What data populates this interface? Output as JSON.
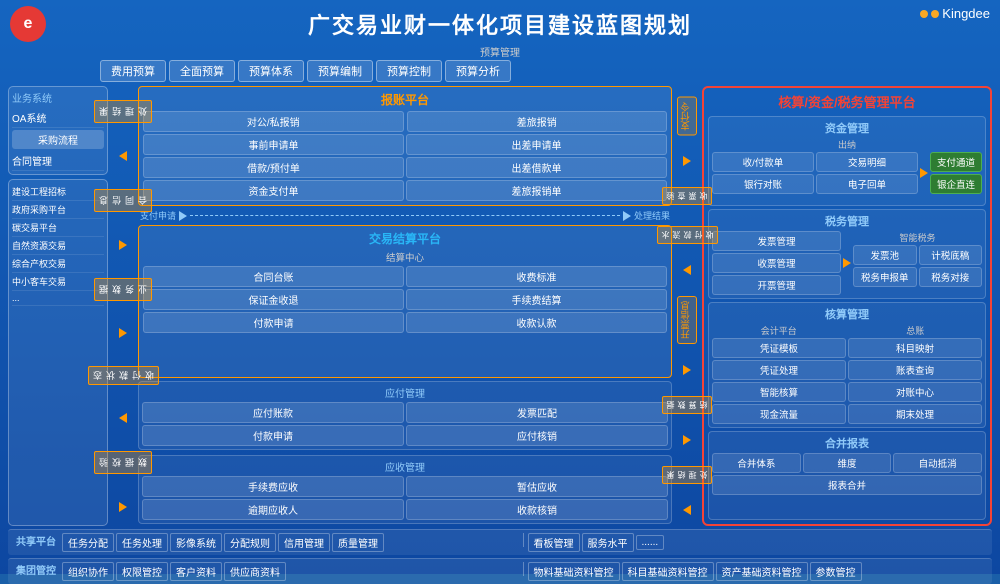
{
  "header": {
    "title": "广交易业财一体化项目建设蓝图规划",
    "logo_left": "e",
    "logo_right": "Kingdee"
  },
  "budget": {
    "label": "预算管理",
    "tabs": [
      "费用预算",
      "全面预算",
      "预算体系",
      "预算编制",
      "预算控制",
      "预算分析"
    ]
  },
  "right_platform": {
    "title": "核算/资金/税务管理平台",
    "fund_section": {
      "title": "资金管理",
      "subsection_title": "出纳",
      "items": [
        "收/付款单",
        "交易明细",
        "银行对账",
        "电子回单"
      ],
      "payment_channel": "支付通道",
      "bank_direct": "银企直连"
    },
    "tax_section": {
      "title": "税务管理",
      "smart_tax": "智能税务",
      "items": [
        "发票管理",
        "收票管理",
        "开票管理"
      ],
      "right_items": [
        "发票池",
        "计税底稿",
        "税务申报单",
        "税务对接"
      ]
    },
    "account_section": {
      "title": "核算管理",
      "platform": "会计平台",
      "general_ledger": "总账",
      "items": [
        "凭证模板",
        "科目映射",
        "凭证处理",
        "账表查询",
        "智能核算",
        "对账中心",
        "现金流量",
        "期末处理"
      ]
    },
    "merge_section": {
      "title": "合并报表",
      "items": [
        "合并体系",
        "维度",
        "自动抵消",
        "报表合并"
      ]
    }
  },
  "left": {
    "biz_section": {
      "title": "业务系统",
      "items": [
        "OA系统",
        "采购流程",
        "合同管理"
      ]
    },
    "project_section": {
      "items": [
        "建设工程招标",
        "政府采购平台",
        "碳交易平台",
        "自然资源交易",
        "综合产权交易",
        "中小客车交易",
        "..."
      ]
    }
  },
  "mid": {
    "expense_platform": {
      "title": "报账平台",
      "sections": {
        "public_expense": "对公/私报销",
        "travel_expense": "差旅报销",
        "pre_apply": "事前申请单",
        "travel_apply": "出差申请单",
        "loan": "借款/预付单",
        "travel_loan": "出差借款单",
        "fund_payment": "资金支付单",
        "travel_reimbursement": "差旅报销单"
      },
      "payment_cmd": "支付令",
      "ticket_check": "收票查验"
    },
    "trade_platform": {
      "title": "交易结算平台",
      "clearing_center": "结算中心",
      "items": [
        "合同台账",
        "收费标准",
        "保证金收退",
        "手续费结算",
        "付款申请",
        "收款认款"
      ],
      "invoice_info": "开票信息"
    },
    "payable_section": {
      "title": "应付管理",
      "items": [
        "应付账款",
        "发票匹配",
        "付款申请",
        "应付核销"
      ]
    },
    "receivable_section": {
      "title": "应收管理",
      "items": [
        "手续费应收",
        "暂估应收",
        "逾期应收人",
        "收款核销"
      ]
    },
    "side_labels": {
      "process_result": "处理结果",
      "contract_info": "合同信息",
      "biz_data": "业务数据",
      "payment_status": "收付款状态",
      "data_check": "数据校验",
      "payment_flow": "收付款流水",
      "settlement_data": "结算数据",
      "invoice_info": "开票信息",
      "process_result2": "处理结果"
    }
  },
  "bottom": {
    "shared_platform": "共享平台",
    "group_control": "集团管控",
    "items1": [
      "任务分配",
      "任务处理",
      "影像系统",
      "分配规则",
      "信用管理",
      "质量管理"
    ],
    "items2": [
      "看板管理",
      "服务水平",
      "......"
    ],
    "items3": [
      "组织协作",
      "权限管控",
      "客户资料",
      "供应商资料"
    ],
    "items4": [
      "物料基础资料管控",
      "科目基础资料管控",
      "资产基础资料管控",
      "参数管控"
    ]
  }
}
